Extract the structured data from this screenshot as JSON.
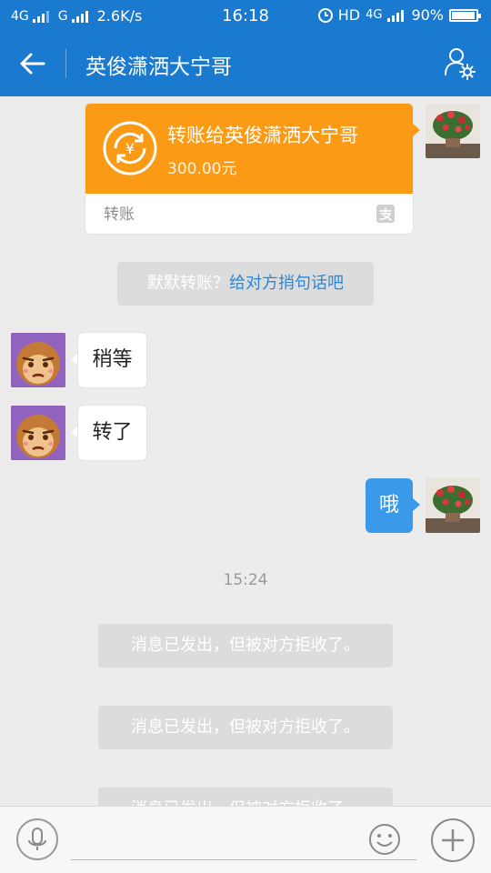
{
  "status_bar": {
    "network1": "4G",
    "network2": "G",
    "speed": "2.6K/s",
    "time": "16:18",
    "hd": "HD",
    "network3": "4G",
    "battery": "90%",
    "battery_level": 0.9
  },
  "header": {
    "title": "英俊潇洒大宁哥"
  },
  "transfer": {
    "title": "转账给英俊潇洒大宁哥",
    "amount": "300.00元",
    "type": "转账",
    "currency_symbol": "¥"
  },
  "tip": {
    "prefix": "默默转账？",
    "link": "给对方捎句话吧"
  },
  "messages": [
    {
      "text": "稍等"
    },
    {
      "text": "转了"
    },
    {
      "text": "哦"
    }
  ],
  "timestamp": "15:24",
  "rejected": [
    "消息已发出，但被对方拒收了。",
    "消息已发出，但被对方拒收了。",
    "消息已发出，但被对方拒收了。"
  ],
  "colors": {
    "header": "#1a7ad0",
    "transfer": "#fb9a15",
    "bubble_self": "#3a99e8",
    "link": "#2e86d6"
  }
}
